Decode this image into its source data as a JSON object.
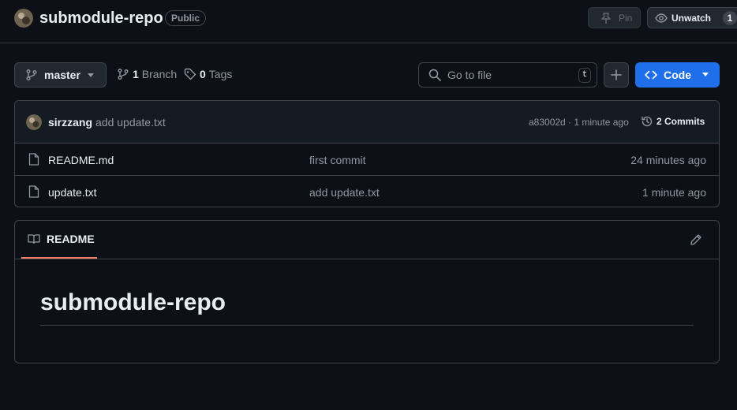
{
  "header": {
    "repo_name": "submodule-repo",
    "visibility": "Public",
    "pin_label": "Pin",
    "unwatch_label": "Unwatch",
    "watch_count": "1"
  },
  "toolbar": {
    "branch": "master",
    "branch_count": "1",
    "branch_label": "Branch",
    "tag_count": "0",
    "tag_label": "Tags",
    "go_to_file_placeholder": "Go to file",
    "go_to_file_shortcut": "t",
    "code_label": "Code"
  },
  "latest_commit": {
    "author": "sirzzang",
    "message": "add update.txt",
    "meta": "a83002d · 1 minute ago",
    "commit_count_label": "2 Commits"
  },
  "files": [
    {
      "name": "README.md",
      "commit": "first commit",
      "age": "24 minutes ago"
    },
    {
      "name": "update.txt",
      "commit": "add update.txt",
      "age": "1 minute ago"
    }
  ],
  "readme": {
    "tab_label": "README",
    "heading": "submodule-repo"
  },
  "colors": {
    "background": "#0d1117",
    "accent": "#1f6feb",
    "tab_underline": "#f78166"
  }
}
